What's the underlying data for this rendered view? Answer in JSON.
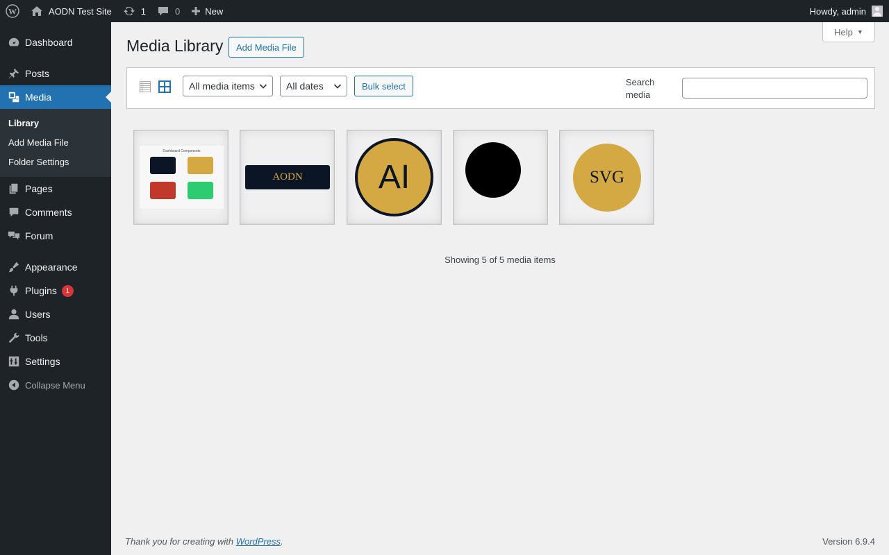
{
  "adminbar": {
    "site_name": "AODN Test Site",
    "updates_count": "1",
    "comments_count": "0",
    "new_label": "New",
    "greeting": "Howdy, admin"
  },
  "sidebar": {
    "items": [
      {
        "label": "Dashboard",
        "icon": "dashboard-icon"
      },
      {
        "label": "Posts",
        "icon": "pin-icon"
      },
      {
        "label": "Media",
        "icon": "media-icon"
      },
      {
        "label": "Pages",
        "icon": "pages-icon"
      },
      {
        "label": "Comments",
        "icon": "comment-icon"
      },
      {
        "label": "Forum",
        "icon": "forum-icon"
      },
      {
        "label": "Appearance",
        "icon": "brush-icon"
      },
      {
        "label": "Plugins",
        "icon": "plugin-icon",
        "badge": "1"
      },
      {
        "label": "Users",
        "icon": "user-icon"
      },
      {
        "label": "Tools",
        "icon": "wrench-icon"
      },
      {
        "label": "Settings",
        "icon": "settings-icon"
      }
    ],
    "media_submenu": [
      "Library",
      "Add Media File",
      "Folder Settings"
    ],
    "collapse_label": "Collapse Menu"
  },
  "header": {
    "help_label": "Help",
    "title": "Media Library",
    "add_button": "Add Media File"
  },
  "toolbar": {
    "type_filter": "All media items",
    "date_filter": "All dates",
    "bulk_select": "Bulk select",
    "search_label": "Search media",
    "search_value": ""
  },
  "media": {
    "thumb1_title": "Dashboard Components",
    "thumb2_text": "AODN",
    "thumb3_text": "AI",
    "thumb5_text": "SVG",
    "showing": "Showing 5 of 5 media items"
  },
  "colors": {
    "accent": "#2271b1",
    "gold": "#d4a843",
    "navy": "#0c1526",
    "red": "#c0392b",
    "green": "#2ecc71"
  },
  "footer": {
    "thanks_prefix": "Thank you for creating with ",
    "thanks_link": "WordPress",
    "thanks_suffix": ".",
    "version": "Version 6.9.4"
  }
}
